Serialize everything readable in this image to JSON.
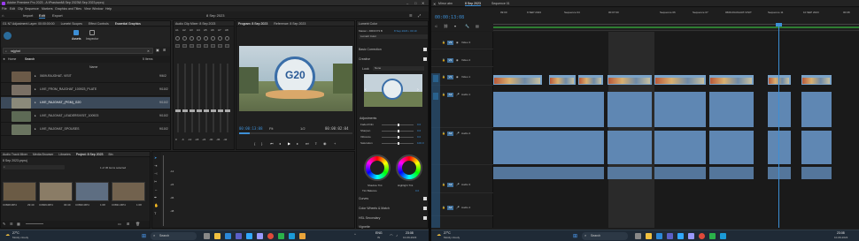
{
  "left": {
    "title": "Adobe Premiere Pro 2023 - A:\\Prashant\\8 Sep 2023\\8 Sep 2023.prproj",
    "menu": [
      "File",
      "Edit",
      "Clip",
      "Sequence",
      "Markers",
      "Graphics and Titles",
      "View",
      "Window",
      "Help"
    ],
    "workspace_tabs": [
      "Import",
      "Edit",
      "Export"
    ],
    "workspace_active": "Edit",
    "center_title": "8 Sep 2023",
    "source_tabs": [
      "G1 N7 Adjustment Layer: 00:00:00:00",
      "Lumetri Scopes",
      "Effect Controls",
      "Essential Graphics",
      "Audio Clip Mixer: 8 Sep 2023"
    ],
    "assets_label": "Assets",
    "inspector_label": "Inspector",
    "search_value": "rajghat",
    "home_label": "Home",
    "search_label": "Search",
    "items_count": "5 Items",
    "name_header": "Name",
    "assets": [
      {
        "name": "0609-RAJGHAT- VISIT",
        "date": "9/6/2",
        "selected": false,
        "color": "#6b5a48"
      },
      {
        "name": "LIVE_FROM_RAJGHAT_100923_PLATE",
        "date": "9/10/2",
        "selected": false,
        "color": "#7a7065"
      },
      {
        "name": "LIVE_RAJGHAT_(PGM)_G20",
        "date": "9/10/2",
        "selected": true,
        "color": "#8b8a7a"
      },
      {
        "name": "LIVE_RAJGHAT_LEADERSVISIT_100923",
        "date": "9/10/2",
        "selected": false,
        "color": "#5d6a55"
      },
      {
        "name": "LIVE_RAJGHAT_SPOUSES",
        "date": "9/10/2",
        "selected": false,
        "color": "#6a7460"
      }
    ],
    "program_tab": "Program: 8 Sep 2023",
    "reference_tab": "Reference: 8 Sep 2023",
    "program_timecode": "00:00:13:08",
    "program_fit": "Fit",
    "program_ratio": "1/2",
    "program_duration": "00:00:02:04",
    "audio_mixer_title": "Audio Clip Mixer: 8 Sep 2023",
    "audio_channels": [
      "A1",
      "A2",
      "A3",
      "A4",
      "A5",
      "A6",
      "A7",
      "A8"
    ],
    "meter_scale": [
      "0",
      "-6",
      "-12",
      "-18",
      "-24",
      "-30",
      "-36",
      "-42",
      "-48",
      "-54"
    ],
    "lumetri_title": "Lumetri Color",
    "lumetri_master": "Master • DR03 P3 B",
    "lumetri_clip": "8 Sep 2023 • 00:10",
    "lumetri_preset": "Lumetri Color",
    "lumetri_sections": [
      "Basic Correction",
      "Creative",
      "Curves",
      "Color Wheels & Match",
      "HSL Secondary",
      "Vignette"
    ],
    "look_label": "Look",
    "look_value": "None",
    "adjustments_label": "Adjustments",
    "sliders": [
      {
        "name": "Faded Film",
        "value": "0.0"
      },
      {
        "name": "Sharpen",
        "value": "0.0"
      },
      {
        "name": "Vibrance",
        "value": "0.0"
      },
      {
        "name": "Saturation",
        "value": "100.0"
      }
    ],
    "shadow_tint": "Shadow Tint",
    "highlight_tint": "Highlight Tint",
    "tint_balance_label": "Tint Balance",
    "tint_balance_value": "0.0",
    "project_tabs": [
      "Audio Track Mixer",
      "Media Browser",
      "Libraries",
      "Project: 8 Sep 2023",
      "Bin"
    ],
    "project_active": "Project: 8 Sep 2023",
    "project_file": "8 Sep 2023.prproj",
    "project_selection": "1 of 36 items selected",
    "project_clips": [
      {
        "name": "C0828.MP4",
        "duration": "29:49"
      },
      {
        "name": "C0829.MP4",
        "duration": "30:49"
      },
      {
        "name": "C0830.MP4",
        "duration": "1:08"
      },
      {
        "name": "C0831.MP4",
        "duration": "1:08"
      }
    ],
    "timeline_ruler_values": [
      "-12",
      "-24",
      "-36",
      "-48"
    ]
  },
  "right": {
    "tabs": [
      "Mirror atm",
      "8 Sep 2023",
      "Sequence 01"
    ],
    "active_tab": "8 Sep 2023",
    "timecode": "00:00:13:08",
    "ruler_markers": [
      "09:00",
      "9 SEP 2023",
      "Sequence 04",
      "00:07:00",
      "Sequence 06",
      "Sequence 07",
      "0609-RAJGHAT-VISIT",
      "Sequence 11",
      "10 SEP 2023",
      "00:08"
    ],
    "video_tracks": [
      "V3",
      "V2",
      "V1"
    ],
    "audio_tracks": [
      "A1",
      "A2",
      "A3",
      "A4"
    ],
    "track_names": {
      "V3": "Video 3",
      "V2": "Video 2",
      "V1": "Video 1",
      "A1": "Audio 1",
      "A2": "Audio 2",
      "A3": "Audio 3",
      "A4": "Audio 4"
    },
    "source_toggles": [
      "V1",
      "A1"
    ]
  },
  "taskbar": {
    "weather_temp": "27°C",
    "weather_text": "Mostly cloudy",
    "search_placeholder": "Search",
    "lang": "ENG",
    "lang_sub": "IN",
    "time": "23:08",
    "date": "10-09-2023"
  },
  "colors": {
    "accent": "#3d8fd6",
    "clip_video": "#7aa3c8",
    "clip_audio": "#5f87b3",
    "selected_row": "#3c4a5a"
  }
}
